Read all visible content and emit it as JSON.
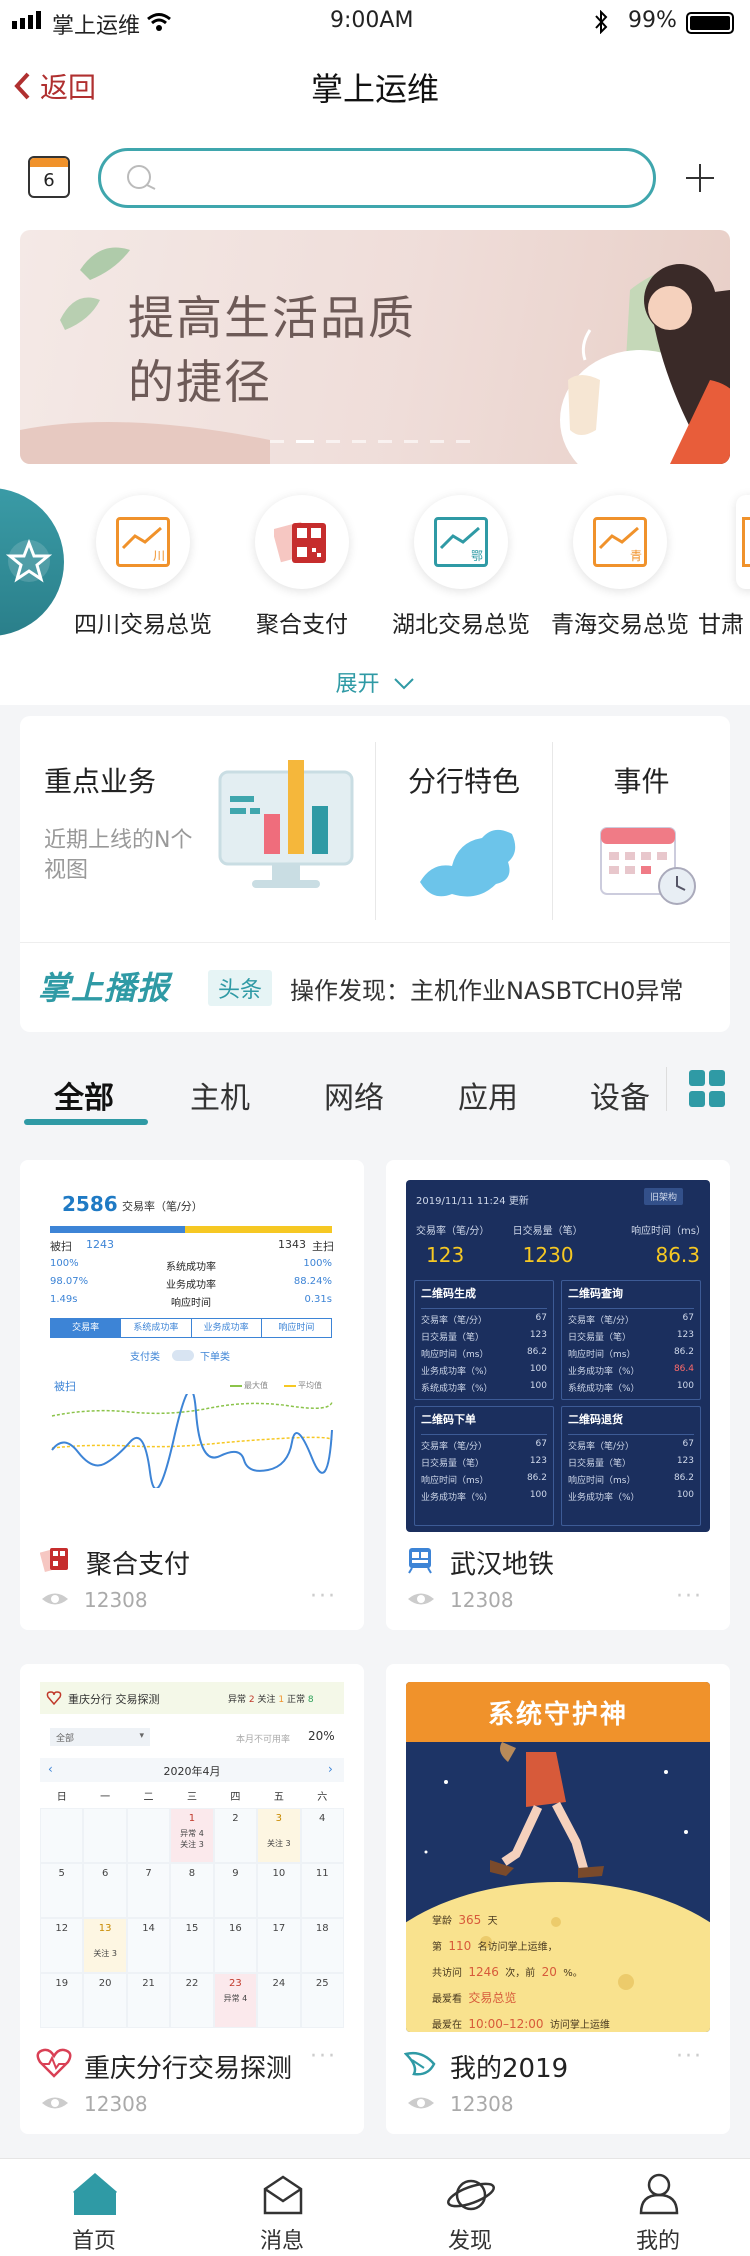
{
  "status_bar": {
    "carrier": "掌上运维",
    "time": "9:00AM",
    "battery": "99%"
  },
  "nav": {
    "back_label": "返回",
    "title": "掌上运维"
  },
  "toolbar": {
    "calendar_day": "6",
    "search_placeholder": ""
  },
  "banner": {
    "line1": "提高生活品质",
    "line2": "的捷径"
  },
  "quick_items": [
    {
      "label": "四川交易总览",
      "icon_char": "川"
    },
    {
      "label": "聚合支付",
      "icon_char": ""
    },
    {
      "label": "湖北交易总览",
      "icon_char": "鄂"
    },
    {
      "label": "青海交易总览",
      "icon_char": "青"
    },
    {
      "label": "甘肃",
      "icon_char": ""
    }
  ],
  "expand_label": "展开",
  "features": {
    "key_business": {
      "title": "重点业务",
      "desc": "近期上线的N个视图"
    },
    "branch": {
      "title": "分行特色"
    },
    "events": {
      "title": "事件"
    }
  },
  "broadcast": {
    "logo": "掌上播报",
    "tag": "头条",
    "text": "操作发现：主机作业NASBTCH0异常"
  },
  "tabs": [
    "全部",
    "主机",
    "网络",
    "应用",
    "设备"
  ],
  "tiles": {
    "t1": {
      "title": "聚合支付",
      "views": "12308",
      "rate": "2586",
      "rate_label": "交易率（笔/分）",
      "left_label": "被扫",
      "left_val": "1243",
      "right_val": "1343",
      "right_label": "主扫",
      "rows": [
        {
          "l": "100%",
          "m": "系统成功率",
          "r": "100%"
        },
        {
          "l": "98.07%",
          "m": "业务成功率",
          "r": "88.24%"
        },
        {
          "l": "1.49s",
          "m": "响应时间",
          "r": "0.31s"
        }
      ],
      "subtabs": [
        "交易率",
        "系统成功率",
        "业务成功率",
        "响应时间"
      ],
      "toggle_l": "支付类",
      "toggle_r": "下单类",
      "chart_label": "被扫",
      "legend_max": "最大值",
      "legend_avg": "平均值"
    },
    "t2": {
      "title": "武汉地铁",
      "views": "12308",
      "date": "2019/11/11  11:24  更新",
      "btn": "旧架构",
      "kpis": [
        {
          "label": "交易率（笔/分）",
          "value": "123"
        },
        {
          "label": "日交易量（笔）",
          "value": "1230"
        },
        {
          "label": "响应时间（ms）",
          "value": "86.3"
        }
      ],
      "boxes": [
        {
          "title": "二维码生成",
          "rows": [
            [
              "交易率（笔/分）",
              "67"
            ],
            [
              "日交易量（笔）",
              "123"
            ],
            [
              "响应时间（ms）",
              "86.2"
            ],
            [
              "业务成功率（%）",
              "100"
            ],
            [
              "系统成功率（%）",
              "100"
            ]
          ]
        },
        {
          "title": "二维码查询",
          "rows": [
            [
              "交易率（笔/分）",
              "67"
            ],
            [
              "日交易量（笔）",
              "123"
            ],
            [
              "响应时间（ms）",
              "86.2"
            ],
            [
              "业务成功率（%）",
              "86.4"
            ],
            [
              "系统成功率（%）",
              "100"
            ]
          ]
        },
        {
          "title": "二维码下单",
          "rows": [
            [
              "交易率（笔/分）",
              "67"
            ],
            [
              "日交易量（笔）",
              "123"
            ],
            [
              "响应时间（ms）",
              "86.2"
            ],
            [
              "业务成功率（%）",
              "100"
            ]
          ]
        },
        {
          "title": "二维码退货",
          "rows": [
            [
              "交易率（笔/分）",
              "67"
            ],
            [
              "日交易量（笔）",
              "123"
            ],
            [
              "响应时间（ms）",
              "86.2"
            ],
            [
              "业务成功率（%）",
              "100"
            ]
          ]
        }
      ]
    },
    "t3": {
      "title": "重庆分行交易探测",
      "views": "12308",
      "head": "重庆分行  交易探测",
      "abn": "异常",
      "abn_n": "2",
      "focus": "关注",
      "focus_n": "1",
      "normal": "正常",
      "normal_n": "8",
      "select": "全部",
      "unavail": "本月不可用率",
      "pct": "20%",
      "month": "2020年4月",
      "weekdays": [
        "日",
        "一",
        "二",
        "三",
        "四",
        "五",
        "六"
      ],
      "days": [
        [
          "",
          "",
          "",
          "1",
          "2",
          "3",
          "4"
        ],
        [
          "5",
          "6",
          "7",
          "8",
          "9",
          "10",
          "11"
        ],
        [
          "12",
          "13",
          "14",
          "15",
          "16",
          "17",
          "18"
        ],
        [
          "19",
          "20",
          "21",
          "22",
          "23",
          "24",
          "25"
        ]
      ],
      "note_abn": "异常 4",
      "note_focus": "关注 3"
    },
    "t4": {
      "title": "我的2019",
      "views": "12308",
      "poster_title": "系统守护神",
      "l1a": "掌龄",
      "l1v": "365",
      "l1b": "天",
      "l2a": "第",
      "l2v": "110",
      "l2b": "名访问掌上运维，",
      "l3a": "共访问",
      "l3v": "1246",
      "l3b": "次，前",
      "l3v2": "20",
      "l3c": "%。",
      "l4a": "最爱看",
      "l4v": "交易总览",
      "l5a": "最爱在",
      "l5v": "10:00–12:00",
      "l5b": "访问掌上运维"
    }
  },
  "bottom_nav": [
    "首页",
    "消息",
    "发现",
    "我的"
  ],
  "colors": {
    "teal": "#2f9aa5",
    "accent_red": "#c0392b",
    "orange": "#f0922b"
  }
}
